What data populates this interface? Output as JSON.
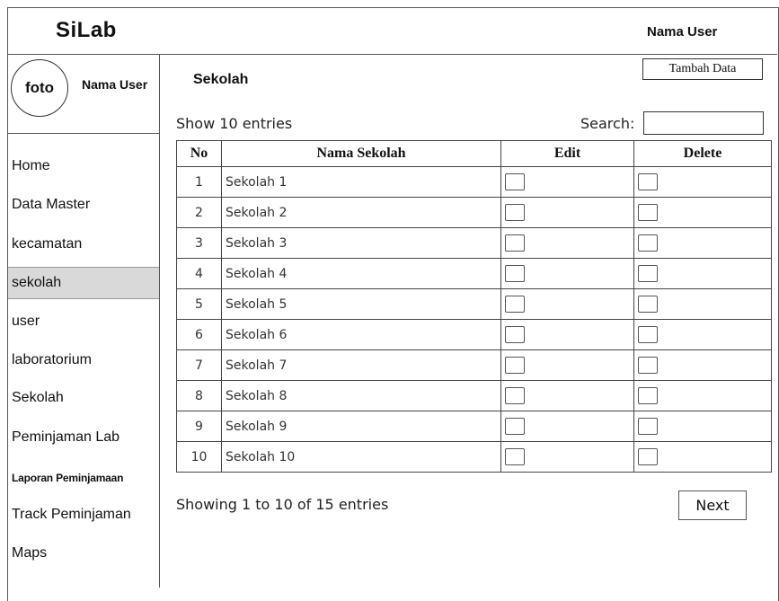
{
  "app": {
    "title": "SiLab",
    "top_user": "Nama User"
  },
  "profile": {
    "avatar_text": "foto",
    "user_name": "Nama User"
  },
  "sidebar": {
    "items": [
      {
        "label": "Home",
        "active": false
      },
      {
        "label": "Data Master",
        "active": false
      },
      {
        "label": "kecamatan",
        "active": false
      },
      {
        "label": "sekolah",
        "active": true
      },
      {
        "label": "user",
        "active": false
      },
      {
        "label": "laboratorium",
        "active": false
      },
      {
        "label": "Sekolah",
        "active": false
      },
      {
        "label": "Peminjaman Lab",
        "active": false
      },
      {
        "label": "Laporan Peminjamaan",
        "active": false
      },
      {
        "label": "Track Peminjaman",
        "active": false
      },
      {
        "label": "Maps",
        "active": false
      }
    ]
  },
  "main": {
    "section_title": "Sekolah",
    "add_button": "Tambah Data",
    "show_entries": "Show 10 entries",
    "search_label": "Search:",
    "search_value": "",
    "table": {
      "headers": [
        "No",
        "Nama Sekolah",
        "Edit",
        "Delete"
      ],
      "rows": [
        {
          "no": "1",
          "name": "Sekolah 1"
        },
        {
          "no": "2",
          "name": "Sekolah 2"
        },
        {
          "no": "3",
          "name": "Sekolah 3"
        },
        {
          "no": "4",
          "name": "Sekolah 4"
        },
        {
          "no": "5",
          "name": "Sekolah 5"
        },
        {
          "no": "6",
          "name": "Sekolah 6"
        },
        {
          "no": "7",
          "name": "Sekolah 7"
        },
        {
          "no": "8",
          "name": "Sekolah 8"
        },
        {
          "no": "9",
          "name": "Sekolah 9"
        },
        {
          "no": "10",
          "name": "Sekolah 10"
        }
      ]
    },
    "showing_text": "Showing 1 to 10 of 15 entries",
    "next_label": "Next"
  }
}
